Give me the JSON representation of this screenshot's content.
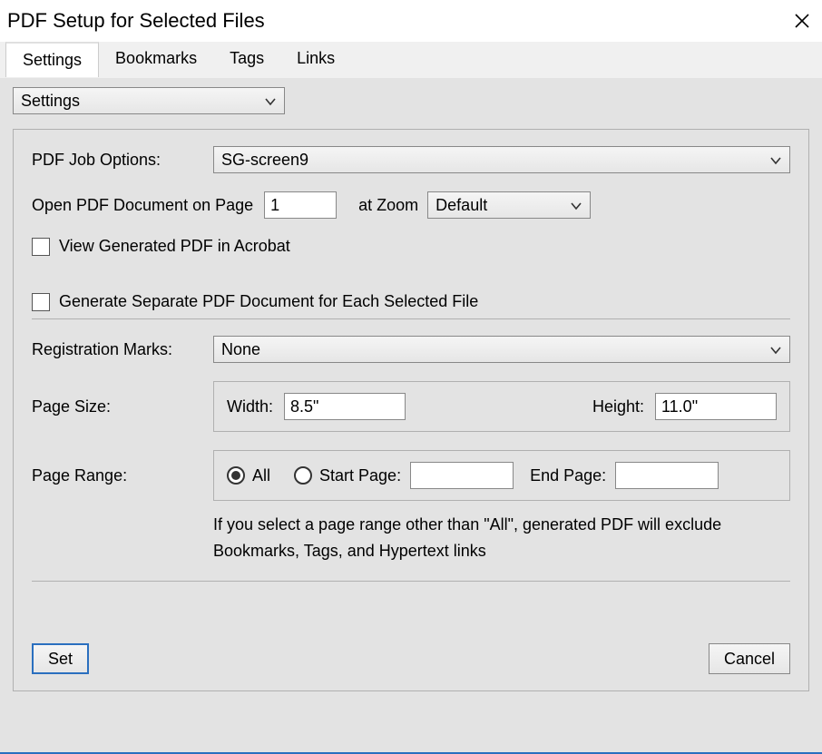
{
  "window": {
    "title": "PDF Setup for Selected Files"
  },
  "tabs": [
    {
      "label": "Settings"
    },
    {
      "label": "Bookmarks"
    },
    {
      "label": "Tags"
    },
    {
      "label": "Links"
    }
  ],
  "section_selector": {
    "value": "Settings"
  },
  "settings": {
    "job_options_label": "PDF Job Options:",
    "job_options_value": "SG-screen9",
    "open_page_label": "Open PDF Document on Page",
    "open_page_value": "1",
    "at_zoom_label": "at Zoom",
    "zoom_value": "Default",
    "view_in_acrobat": "View Generated PDF in Acrobat",
    "view_in_acrobat_checked": false,
    "separate_each_file": "Generate Separate PDF Document for Each Selected File",
    "separate_each_file_checked": false,
    "registration_label": "Registration Marks:",
    "registration_value": "None",
    "page_size_label": "Page Size:",
    "width_label": "Width:",
    "width_value": "8.5\"",
    "height_label": "Height:",
    "height_value": "11.0\"",
    "page_range_label": "Page Range:",
    "all_label": "All",
    "start_page_label": "Start Page:",
    "start_page_value": "",
    "end_page_label": "End Page:",
    "end_page_value": "",
    "range_note": "If you select a page range other than \"All\",  generated PDF will exclude Bookmarks, Tags, and Hypertext links"
  },
  "buttons": {
    "set": "Set",
    "cancel": "Cancel"
  }
}
